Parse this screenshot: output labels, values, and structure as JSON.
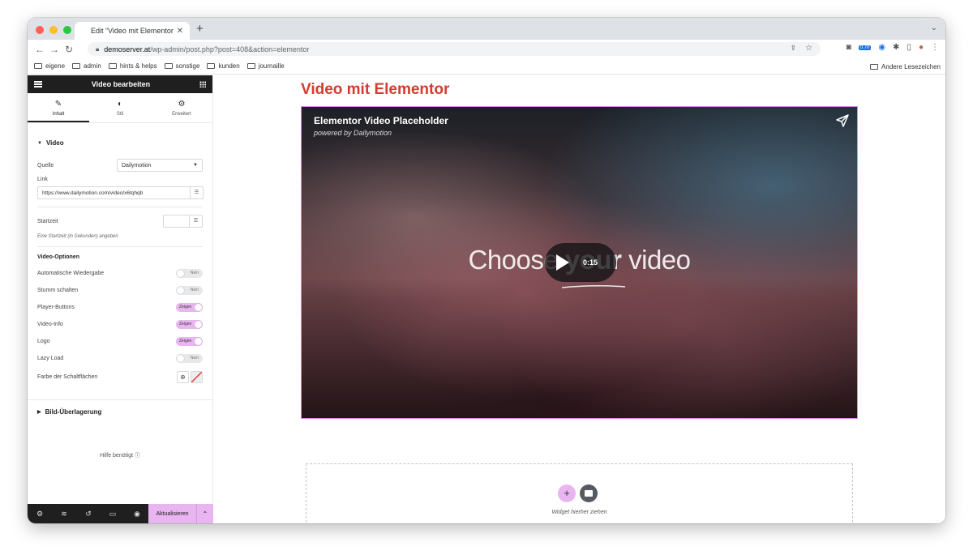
{
  "browser": {
    "tab_title": "Edit “Video mit Elementor” wit",
    "url_host": "demoserver.at",
    "url_path": "/wp-admin/post.php?post=408&action=elementor",
    "extension_badge": "0.70",
    "bookmarks": [
      "eigene",
      "admin",
      "hints & helps",
      "sonstige",
      "kunden",
      "journaille"
    ],
    "other_bookmarks": "Andere Lesezeichen"
  },
  "panel": {
    "header_title": "Video bearbeiten",
    "tabs": [
      {
        "label": "Inhalt",
        "icon": "pencil-icon"
      },
      {
        "label": "Stil",
        "icon": "contrast-icon"
      },
      {
        "label": "Erweitert",
        "icon": "gear-icon"
      }
    ],
    "section_video": "Video",
    "source_label": "Quelle",
    "source_value": "Dailymotion",
    "link_label": "Link",
    "link_value": "https://www.dailymotion.com/video/x6tqhqb",
    "start_label": "Startzeit",
    "start_hint": "Eine Startzeit (in Sekunden) angeben",
    "options_heading": "Video-Optionen",
    "toggles": [
      {
        "label": "Automatische Wiedergabe",
        "state": "Nein"
      },
      {
        "label": "Stumm schalten",
        "state": "Nein"
      },
      {
        "label": "Player-Buttons",
        "state": "Zeigen"
      },
      {
        "label": "Video-Info",
        "state": "Zeigen"
      },
      {
        "label": "Logo",
        "state": "Zeigen"
      },
      {
        "label": "Lazy Load",
        "state": "Nein"
      }
    ],
    "button_color_label": "Farbe der Schaltflächen",
    "section_overlay": "Bild-Überlagerung",
    "help_text": "Hilfe benötigt",
    "update_button": "Aktualisieren"
  },
  "canvas": {
    "heading": "Video mit Elementor",
    "video_title": "Elementor Video Placeholder",
    "video_subtitle": "powered by Dailymotion",
    "choose_pre": "Choose ",
    "choose_bold": "your",
    "choose_post": " video",
    "duration": "0:15",
    "drop_text": "Widget hierher ziehen"
  },
  "colors": {
    "accent": "#e8b5f0",
    "heading": "#d33c2f",
    "panel_dark": "#1f1f1f"
  }
}
